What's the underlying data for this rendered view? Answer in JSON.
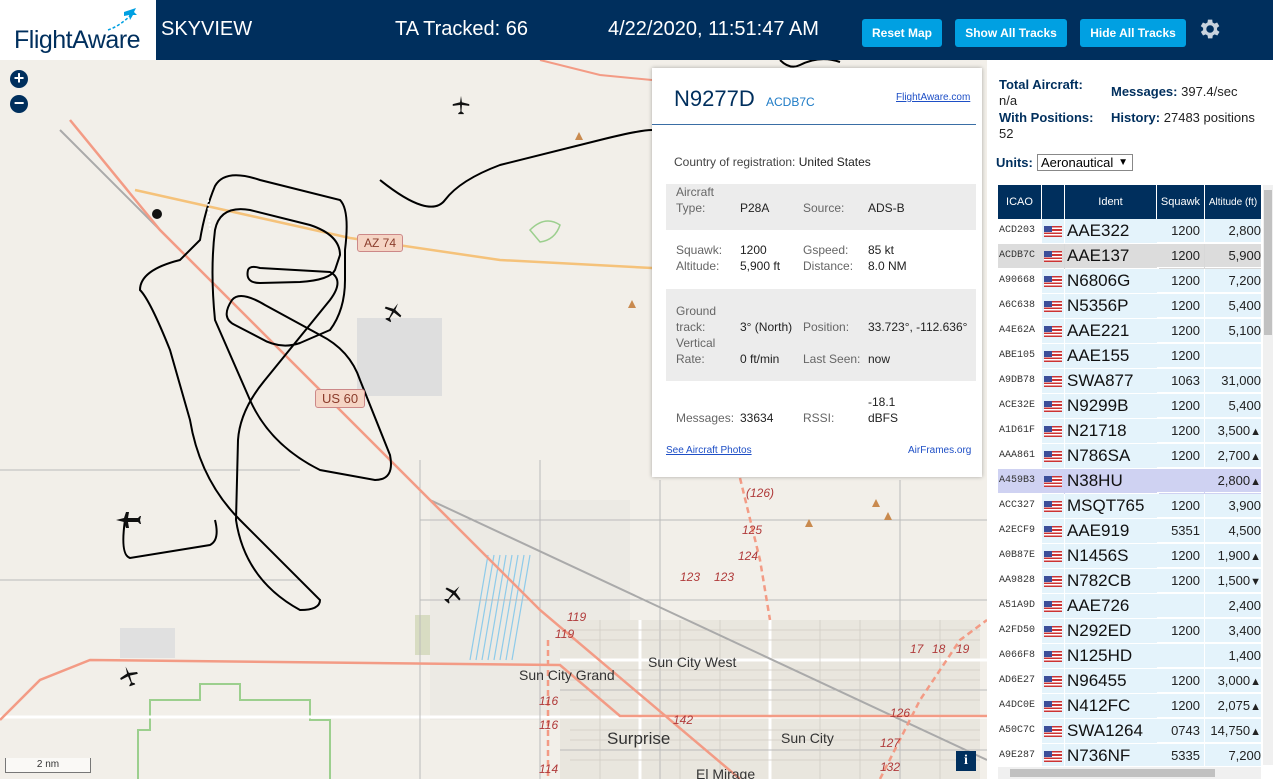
{
  "header": {
    "logo_text": "FlightAware",
    "site_title": "SKYVIEW",
    "tracked_label": "TA Tracked: 66",
    "datetime": "4/22/2020, 11:51:47 AM",
    "buttons": {
      "reset_map": "Reset Map",
      "show_all_tracks": "Show All Tracks",
      "hide_all_tracks": "Hide All Tracks"
    },
    "colors": {
      "header_bg": "#002f5d",
      "button_bg": "#00a0e2"
    }
  },
  "map": {
    "zoom_in": "+",
    "zoom_out": "−",
    "scale_label": "2 nm",
    "info_button": "i",
    "place_labels": [
      "Sun City West",
      "Sun City Grand",
      "Surprise",
      "Sun City",
      "El Mirage"
    ],
    "road_labels": {
      "az74": "AZ 74",
      "us60": "US 60"
    },
    "route_numbers": [
      "(126)",
      "125",
      "124",
      "123",
      "123",
      "119",
      "119",
      "116",
      "116",
      "114",
      "142",
      "17",
      "18",
      "19",
      "126",
      "132",
      "127"
    ],
    "track_color": "#000000"
  },
  "popup": {
    "registration": "N9277D",
    "icao": "ACDB7C",
    "flightaware_link": "FlightAware.com",
    "country_label": "Country of registration:",
    "country_value": "United States",
    "aircraft_type_label": "Aircraft Type:",
    "aircraft_type_value": "P28A",
    "source_label": "Source:",
    "source_value": "ADS-B",
    "squawk_label": "Squawk:",
    "squawk_value": "1200",
    "gspeed_label": "Gspeed:",
    "gspeed_value": "85 kt",
    "altitude_label": "Altitude:",
    "altitude_value": "5,900 ft",
    "distance_label": "Distance:",
    "distance_value": "8.0 NM",
    "ground_track_label": "Ground track:",
    "ground_track_value": "3° (North)",
    "position_label": "Position:",
    "position_value": "33.723°, -112.636°",
    "vertical_rate_label": "Vertical Rate:",
    "vertical_rate_value": "0 ft/min",
    "last_seen_label": "Last Seen:",
    "last_seen_value": "now",
    "messages_label": "Messages:",
    "messages_value": "33634",
    "rssi_label": "RSSI:",
    "rssi_value": "-18.1 dBFS",
    "photos_link": "See Aircraft Photos",
    "airframes_link": "AirFrames.org"
  },
  "sidebar": {
    "total_aircraft_label": "Total Aircraft:",
    "total_aircraft_value": "n/a",
    "messages_label": "Messages:",
    "messages_value": "397.4/sec",
    "with_positions_label": "With Positions:",
    "with_positions_value": "52",
    "history_label": "History:",
    "history_value": "27483 positions",
    "units_label": "Units:",
    "units_value": "Aeronautical",
    "table_headers": {
      "icao": "ICAO",
      "ident": "Ident",
      "squawk": "Squawk",
      "altitude": "Altitude (ft)"
    },
    "rows": [
      {
        "icao": "ACD203",
        "ident": "AAE322",
        "squawk": "1200",
        "altitude": "2,800",
        "trend": ""
      },
      {
        "icao": "ACDB7C",
        "ident": "AAE137",
        "squawk": "1200",
        "altitude": "5,900",
        "trend": ""
      },
      {
        "icao": "A90668",
        "ident": "N6806G",
        "squawk": "1200",
        "altitude": "7,200",
        "trend": ""
      },
      {
        "icao": "A6C638",
        "ident": "N5356P",
        "squawk": "1200",
        "altitude": "5,400",
        "trend": ""
      },
      {
        "icao": "A4E62A",
        "ident": "AAE221",
        "squawk": "1200",
        "altitude": "5,100",
        "trend": ""
      },
      {
        "icao": "ABE105",
        "ident": "AAE155",
        "squawk": "1200",
        "altitude": "",
        "trend": ""
      },
      {
        "icao": "A9DB78",
        "ident": "SWA877",
        "squawk": "1063",
        "altitude": "31,000",
        "trend": ""
      },
      {
        "icao": "ACE32E",
        "ident": "N9299B",
        "squawk": "1200",
        "altitude": "5,400",
        "trend": ""
      },
      {
        "icao": "A1D61F",
        "ident": "N21718",
        "squawk": "1200",
        "altitude": "3,500",
        "trend": "▲"
      },
      {
        "icao": "AAA861",
        "ident": "N786SA",
        "squawk": "1200",
        "altitude": "2,700",
        "trend": "▲"
      },
      {
        "icao": "A459B3",
        "ident": "N38HU",
        "squawk": "",
        "altitude": "2,800",
        "trend": "▲"
      },
      {
        "icao": "ACC327",
        "ident": "MSQT765",
        "squawk": "1200",
        "altitude": "3,900",
        "trend": ""
      },
      {
        "icao": "A2ECF9",
        "ident": "AAE919",
        "squawk": "5351",
        "altitude": "4,500",
        "trend": ""
      },
      {
        "icao": "A0B87E",
        "ident": "N1456S",
        "squawk": "1200",
        "altitude": "1,900",
        "trend": "▲"
      },
      {
        "icao": "AA9828",
        "ident": "N782CB",
        "squawk": "1200",
        "altitude": "1,500",
        "trend": "▼"
      },
      {
        "icao": "A51A9D",
        "ident": "AAE726",
        "squawk": "",
        "altitude": "2,400",
        "trend": ""
      },
      {
        "icao": "A2FD50",
        "ident": "N292ED",
        "squawk": "1200",
        "altitude": "3,400",
        "trend": ""
      },
      {
        "icao": "A066F8",
        "ident": "N125HD",
        "squawk": "",
        "altitude": "1,400",
        "trend": ""
      },
      {
        "icao": "AD6E27",
        "ident": "N96455",
        "squawk": "1200",
        "altitude": "3,000",
        "trend": "▲"
      },
      {
        "icao": "A4DC0E",
        "ident": "N412FC",
        "squawk": "1200",
        "altitude": "2,075",
        "trend": "▲"
      },
      {
        "icao": "A50C7C",
        "ident": "SWA1264",
        "squawk": "0743",
        "altitude": "14,750",
        "trend": "▲"
      },
      {
        "icao": "A9E287",
        "ident": "N736NF",
        "squawk": "5335",
        "altitude": "7,200",
        "trend": ""
      }
    ]
  }
}
